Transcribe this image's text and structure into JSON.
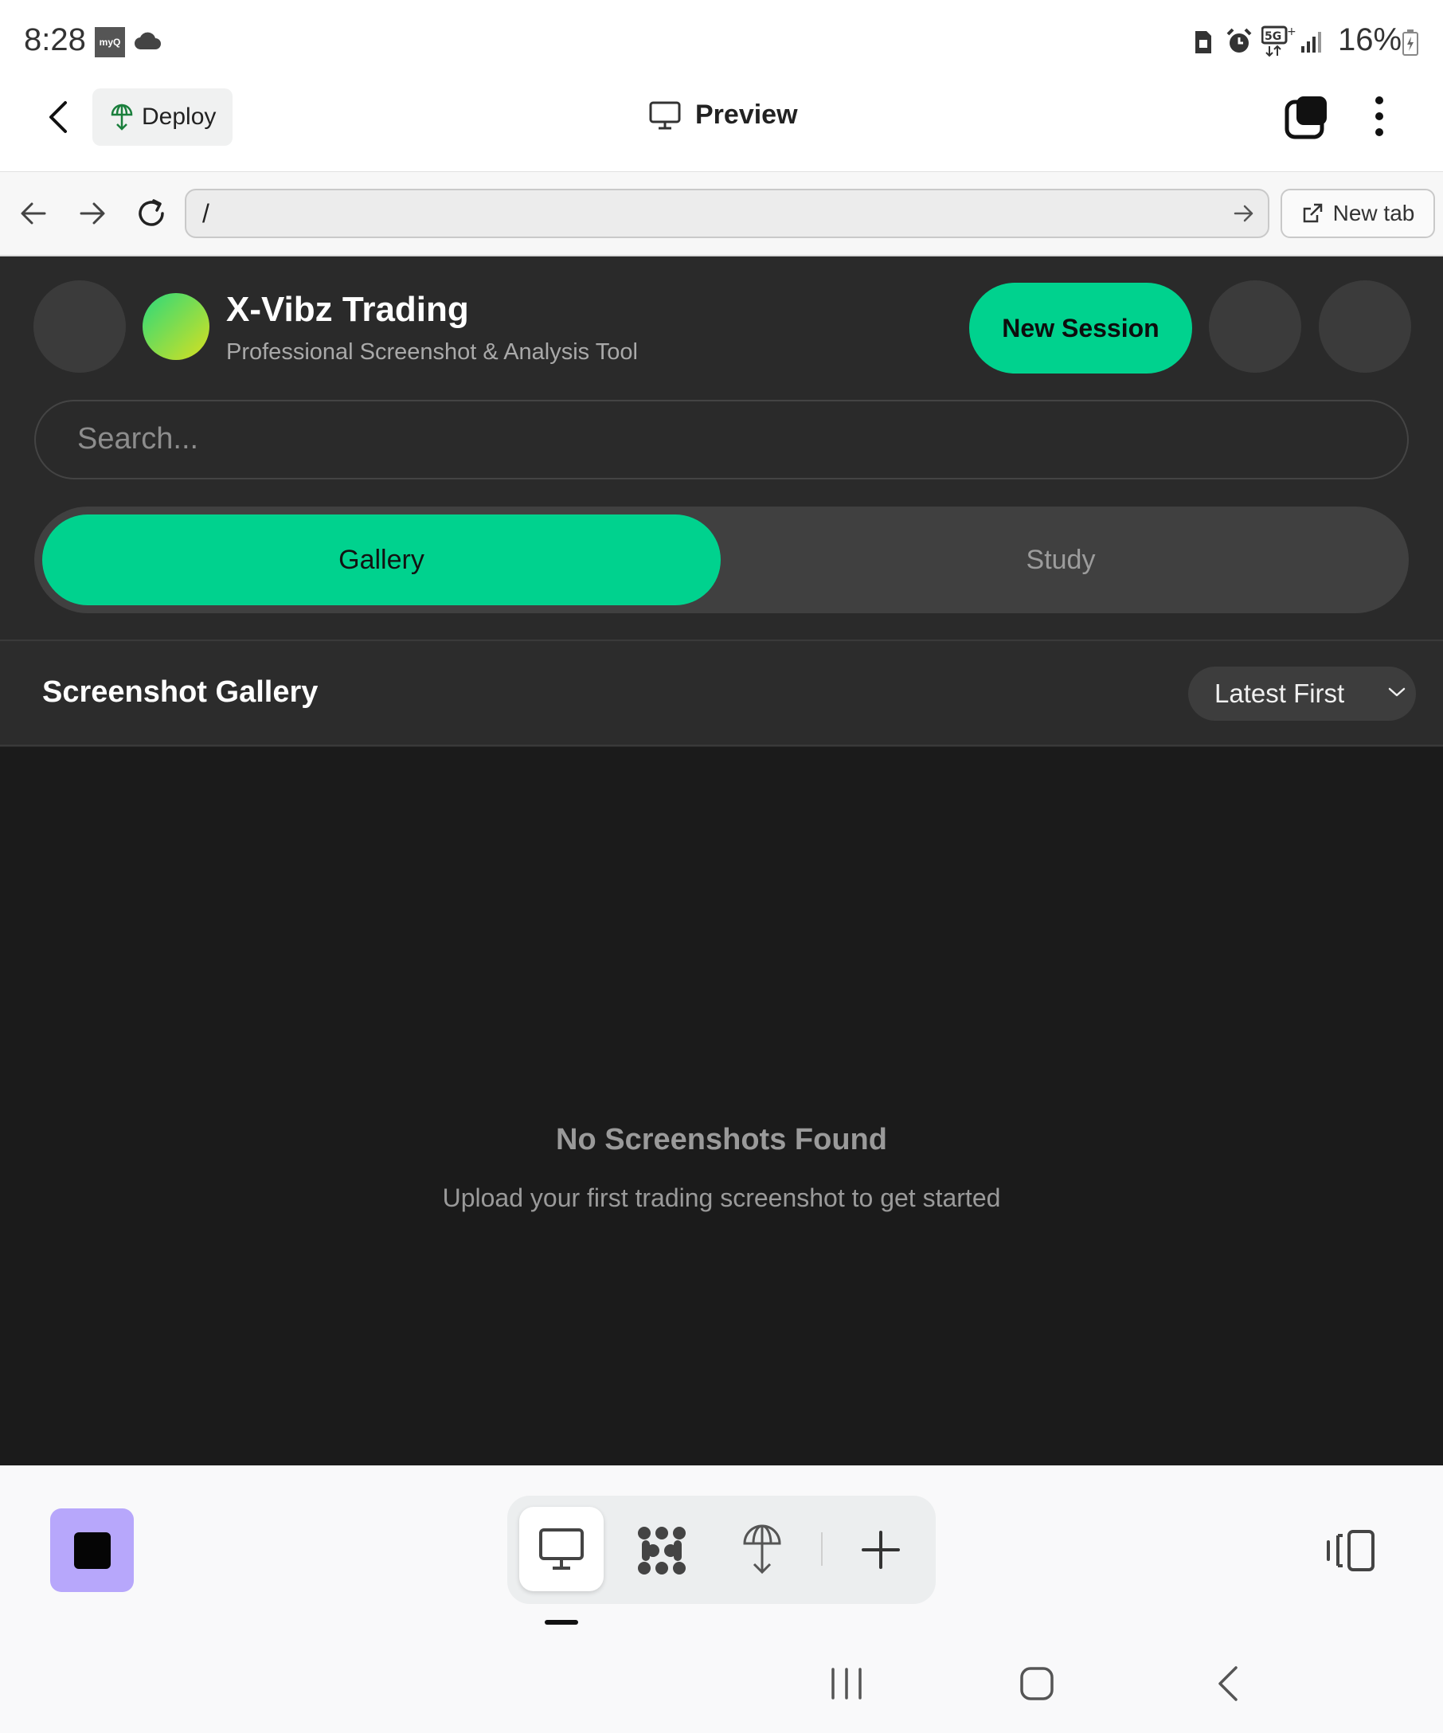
{
  "status_bar": {
    "time": "8:28",
    "carrier_icon": "myQ",
    "battery": "16%",
    "icons": [
      "cloud-icon",
      "sim-icon",
      "alarm-icon",
      "5g-icon",
      "signal-icon",
      "battery-icon"
    ]
  },
  "app_header": {
    "deploy_label": "Deploy",
    "preview_label": "Preview"
  },
  "browser": {
    "url": "/",
    "new_tab_label": "New tab"
  },
  "web_app": {
    "title": "X-Vibz Trading",
    "subtitle": "Professional Screenshot & Analysis Tool",
    "new_session_label": "New Session",
    "search_placeholder": "Search...",
    "tabs": [
      {
        "label": "Gallery",
        "active": true
      },
      {
        "label": "Study",
        "active": false
      }
    ],
    "section_title": "Screenshot Gallery",
    "sort_value": "Latest First",
    "empty_title": "No Screenshots Found",
    "empty_subtitle": "Upload your first trading screenshot to get started"
  },
  "colors": {
    "accent": "#00d28e",
    "app_bg": "#2a2a2a",
    "gallery_bg": "#1b1b1b",
    "stop_button": "#b7a7fb"
  }
}
